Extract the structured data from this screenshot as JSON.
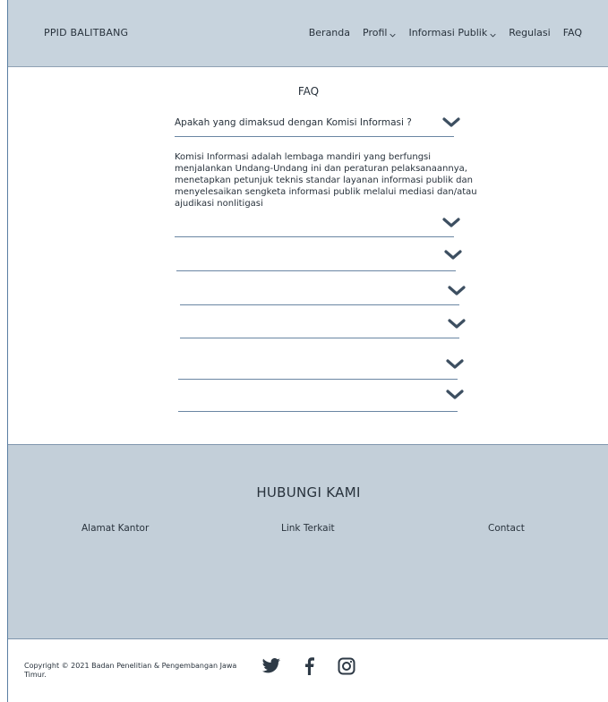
{
  "header": {
    "brand": "PPID BALITBANG",
    "nav": [
      {
        "label": "Beranda",
        "dropdown": false
      },
      {
        "label": "Profil",
        "dropdown": true
      },
      {
        "label": "Informasi Publik",
        "dropdown": true
      },
      {
        "label": "Regulasi",
        "dropdown": false
      },
      {
        "label": "FAQ",
        "dropdown": false
      }
    ]
  },
  "faq": {
    "title": "FAQ",
    "items": [
      {
        "question": "Apakah yang dimaksud dengan Komisi Informasi ?",
        "answer": "Komisi Informasi adalah lembaga mandiri yang berfungsi menjalankan Undang-Undang ini dan peraturan pelaksanaannya, menetapkan petunjuk teknis standar layanan informasi publik dan menyelesaikan sengketa informasi publik melalui mediasi dan/atau ajudikasi nonlitigasi",
        "expanded": true
      },
      {
        "question": "",
        "expanded": false
      },
      {
        "question": "",
        "expanded": false
      },
      {
        "question": "",
        "expanded": false
      },
      {
        "question": "",
        "expanded": false
      },
      {
        "question": "",
        "expanded": false
      },
      {
        "question": "",
        "expanded": false
      }
    ]
  },
  "contact": {
    "title": "HUBUNGI KAMI",
    "columns": [
      "Alamat Kantor",
      "Link Terkait",
      "Contact"
    ]
  },
  "footer": {
    "copyright": "Copyright © 2021 Badan Penelitian & Pengembangan Jawa Timur.",
    "social": [
      "twitter-icon",
      "facebook-icon",
      "instagram-icon"
    ]
  },
  "colors": {
    "header_bg": "#c7d3dd",
    "contact_bg": "#c3cfd9",
    "divider": "#6a86a3",
    "chevron": "#3d4f61"
  }
}
